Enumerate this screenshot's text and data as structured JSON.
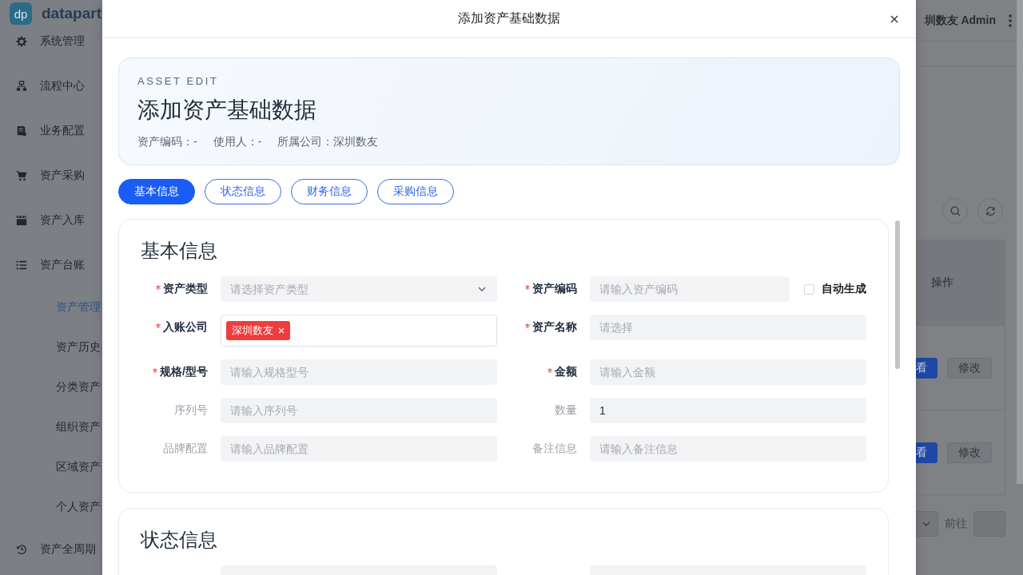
{
  "sidebar": {
    "logo": {
      "mark": "dp",
      "name": "datapart"
    },
    "items": [
      {
        "label": "系统管理"
      },
      {
        "label": "流程中心"
      },
      {
        "label": "业务配置"
      },
      {
        "label": "资产采购"
      },
      {
        "label": "资产入库"
      },
      {
        "label": "资产台账",
        "children": [
          {
            "label": "资产管理",
            "selected": true
          },
          {
            "label": "资产历史",
            "selected": false
          },
          {
            "label": "分类资产",
            "selected": false
          },
          {
            "label": "组织资产",
            "selected": false
          },
          {
            "label": "区域资产",
            "selected": false
          },
          {
            "label": "个人资产",
            "selected": false
          }
        ]
      },
      {
        "label": "资产全周期"
      }
    ]
  },
  "header": {
    "user": "圳数友 Admin"
  },
  "table": {
    "columns": [
      "操作"
    ],
    "rows": [
      {
        "actions": [
          {
            "label": "看",
            "kind": "primary"
          },
          {
            "label": "修改",
            "kind": "default"
          }
        ]
      },
      {
        "actions": [
          {
            "label": "看",
            "kind": "primary"
          },
          {
            "label": "修改",
            "kind": "default"
          }
        ]
      }
    ]
  },
  "pagination": {
    "goto_label": "前往"
  },
  "dialog": {
    "title": "添加资产基础数据",
    "hero": {
      "eyebrow": "ASSET EDIT",
      "title": "添加资产基础数据",
      "meta": [
        "资产编码：-",
        "使用人：-",
        "所属公司：深圳数友"
      ]
    },
    "tabs": [
      {
        "label": "基本信息",
        "selected": true
      },
      {
        "label": "状态信息",
        "selected": false
      },
      {
        "label": "财务信息",
        "selected": false
      },
      {
        "label": "采购信息",
        "selected": false
      }
    ],
    "sections": [
      {
        "title": "基本信息",
        "fields": [
          {
            "label": "资产类型",
            "required": true,
            "kind": "select",
            "placeholder": "请选择资产类型"
          },
          {
            "label": "资产编码",
            "required": true,
            "kind": "input_check",
            "placeholder": "请输入资产编码",
            "checkbox": {
              "label": "自动生成",
              "checked": false
            }
          },
          {
            "label": "入账公司",
            "required": true,
            "kind": "tags",
            "tags": [
              "深圳数友"
            ]
          },
          {
            "label": "资产名称",
            "required": true,
            "kind": "input",
            "placeholder": "请选择"
          },
          {
            "label": "规格/型号",
            "required": true,
            "kind": "input",
            "placeholder": "请输入规格型号"
          },
          {
            "label": "金额",
            "required": true,
            "kind": "input",
            "placeholder": "请输入金额"
          },
          {
            "label": "序列号",
            "required": false,
            "kind": "input",
            "placeholder": "请输入序列号"
          },
          {
            "label": "数量",
            "required": false,
            "kind": "input",
            "value": "1"
          },
          {
            "label": "品牌配置",
            "required": false,
            "kind": "input",
            "placeholder": "请输入品牌配置"
          },
          {
            "label": "备注信息",
            "required": false,
            "kind": "input",
            "placeholder": "请输入备注信息"
          }
        ]
      },
      {
        "title": "状态信息",
        "fields": [
          {
            "kind": "input"
          },
          {
            "kind": "input"
          }
        ]
      }
    ]
  }
}
